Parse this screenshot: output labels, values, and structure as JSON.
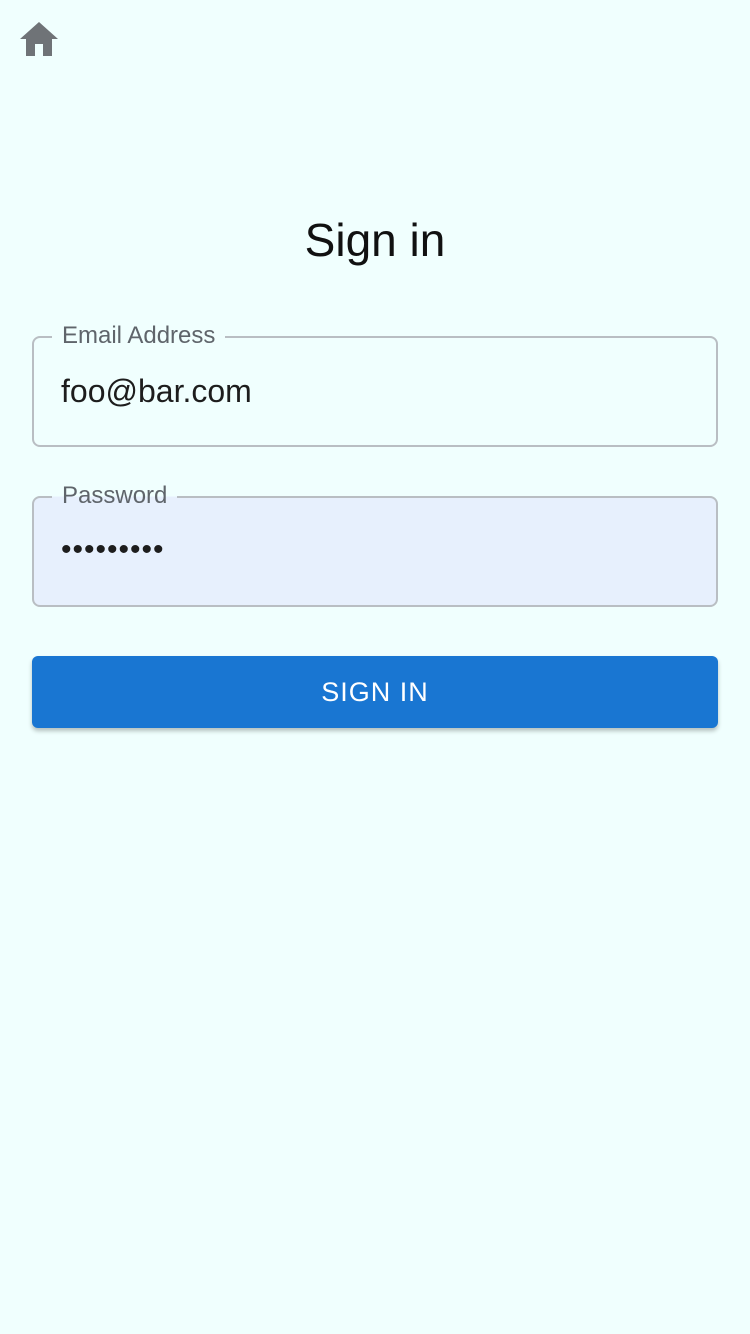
{
  "header": {
    "home_icon": "home-icon"
  },
  "page": {
    "title": "Sign in"
  },
  "form": {
    "email": {
      "label": "Email Address",
      "value": "foo@bar.com"
    },
    "password": {
      "label": "Password",
      "value": "•••••••••"
    },
    "submit_label": "SIGN IN"
  },
  "colors": {
    "background": "#f0fffe",
    "primary": "#1976d2",
    "autofill_background": "#e7f0fd"
  }
}
